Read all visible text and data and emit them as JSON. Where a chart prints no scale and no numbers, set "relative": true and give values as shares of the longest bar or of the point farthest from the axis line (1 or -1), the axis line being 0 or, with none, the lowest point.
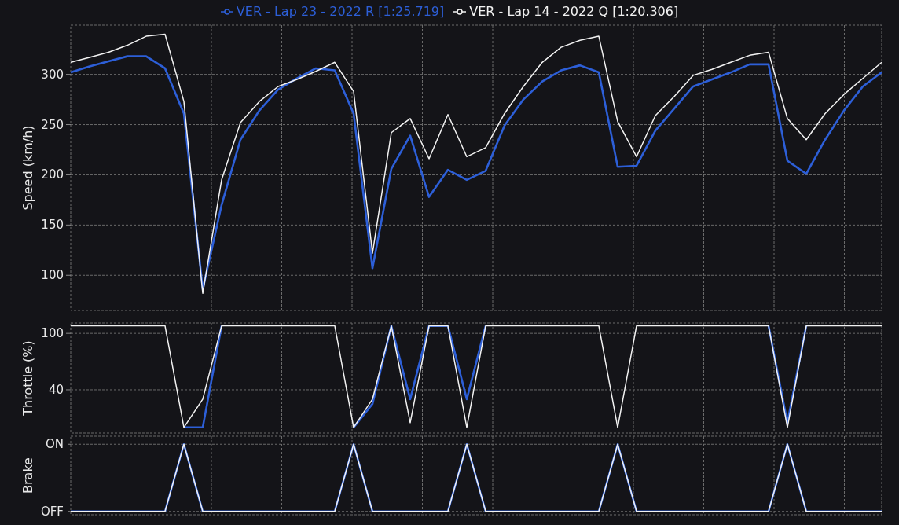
{
  "charts": [
    {
      "chart_data": {
        "type": "line",
        "grid": true,
        "ylabel": "Speed (km/h)",
        "categories": [
          null,
          null,
          null,
          null,
          null,
          null,
          null,
          null,
          null,
          null,
          null,
          null,
          null,
          null,
          null,
          null,
          null,
          null,
          null,
          null,
          null,
          null,
          null,
          null,
          null,
          null,
          null,
          null,
          null,
          null,
          null,
          null,
          null,
          null,
          null,
          null,
          null,
          null,
          null,
          null,
          null,
          null,
          null,
          null
        ],
        "ylim": [
          65,
          349
        ],
        "yticks": [
          100,
          150,
          200,
          250,
          300
        ],
        "series": [
          {
            "name": "VER - Lap 23 - 2022 R [1:25.719]",
            "color": "#2d5fd8",
            "values": [
              302,
              308,
              313,
              318,
              318,
              306,
              261,
              86,
              170,
              235,
              264,
              285,
              296,
              306,
              304,
              261,
              107,
              206,
              239,
              178,
              205,
              195,
              204,
              249,
              275,
              293,
              304,
              309,
              302,
              208,
              209,
              244,
              266,
              288,
              295,
              302,
              310,
              310,
              214,
              201,
              235,
              264,
              288,
              302
            ]
          },
          {
            "name": "VER - Lap 14 - 2022 Q [1:20.306]",
            "color": "#f2f2f2",
            "values": [
              312,
              317,
              322,
              329,
              338,
              340,
              273,
              82,
              195,
              252,
              273,
              288,
              295,
              303,
              312,
              283,
              122,
              242,
              256,
              216,
              260,
              218,
              227,
              261,
              288,
              312,
              327,
              334,
              338,
              253,
              218,
              259,
              278,
              299,
              305,
              312,
              319,
              322,
              256,
              235,
              261,
              280,
              296,
              312
            ]
          }
        ]
      }
    },
    {
      "chart_data": {
        "type": "line",
        "grid": true,
        "ylabel": "Throttle (%)",
        "categories": [
          null,
          null,
          null,
          null,
          null,
          null,
          null,
          null,
          null,
          null,
          null,
          null,
          null,
          null,
          null,
          null,
          null,
          null,
          null,
          null,
          null,
          null,
          null,
          null,
          null,
          null,
          null,
          null,
          null,
          null,
          null,
          null,
          null,
          null,
          null,
          null,
          null,
          null,
          null,
          null,
          null,
          null,
          null,
          null
        ],
        "ylim": [
          -6,
          111
        ],
        "yticks": [
          40,
          100
        ],
        "series": [
          {
            "color": "#2d5fd8",
            "values": [
              null,
              null,
              null,
              null,
              null,
              null,
              0,
              0,
              108,
              null,
              null,
              null,
              null,
              null,
              null,
              0,
              25,
              108,
              30,
              108,
              108,
              30,
              108,
              null,
              null,
              null,
              null,
              null,
              null,
              null,
              null,
              null,
              null,
              null,
              null,
              null,
              null,
              108,
              5,
              108,
              null,
              null,
              null,
              null
            ]
          },
          {
            "color": "#f2f2f2",
            "values": [
              108,
              108,
              108,
              108,
              108,
              108,
              0,
              30,
              108,
              108,
              108,
              108,
              108,
              108,
              108,
              0,
              30,
              108,
              5,
              108,
              108,
              0,
              108,
              108,
              108,
              108,
              108,
              108,
              108,
              0,
              108,
              108,
              108,
              108,
              108,
              108,
              108,
              108,
              0,
              108,
              108,
              108,
              108,
              108
            ]
          }
        ]
      }
    },
    {
      "chart_data": {
        "type": "line",
        "grid": true,
        "relative": true,
        "ylabel": "Brake",
        "categories": [
          null,
          null,
          null,
          null,
          null,
          null,
          null,
          null,
          null,
          null,
          null,
          null,
          null,
          null,
          null,
          null,
          null,
          null,
          null,
          null,
          null,
          null,
          null,
          null,
          null,
          null,
          null,
          null,
          null,
          null,
          null,
          null,
          null,
          null,
          null,
          null,
          null,
          null,
          null,
          null,
          null,
          null,
          null,
          null
        ],
        "ylim": [
          -0.05,
          1.12
        ],
        "annotations": [
          "OFF",
          "ON"
        ],
        "series": [
          {
            "color": "#2d5fd8",
            "values": [
              0,
              0,
              0,
              0,
              0,
              0,
              1,
              0,
              0,
              0,
              0,
              0,
              0,
              0,
              0,
              1,
              0,
              0,
              0,
              0,
              0,
              1,
              0,
              0,
              0,
              0,
              0,
              0,
              0,
              1,
              0,
              0,
              0,
              0,
              0,
              0,
              0,
              0,
              1,
              0,
              0,
              0,
              0,
              0
            ]
          },
          {
            "color": "#f2f2f2",
            "values": [
              0,
              0,
              0,
              0,
              0,
              0,
              1,
              0,
              0,
              0,
              0,
              0,
              0,
              0,
              0,
              1,
              0,
              0,
              0,
              0,
              0,
              1,
              0,
              0,
              0,
              0,
              0,
              0,
              0,
              1,
              0,
              0,
              0,
              0,
              0,
              0,
              0,
              0,
              1,
              0,
              0,
              0,
              0,
              0
            ]
          }
        ]
      }
    }
  ]
}
